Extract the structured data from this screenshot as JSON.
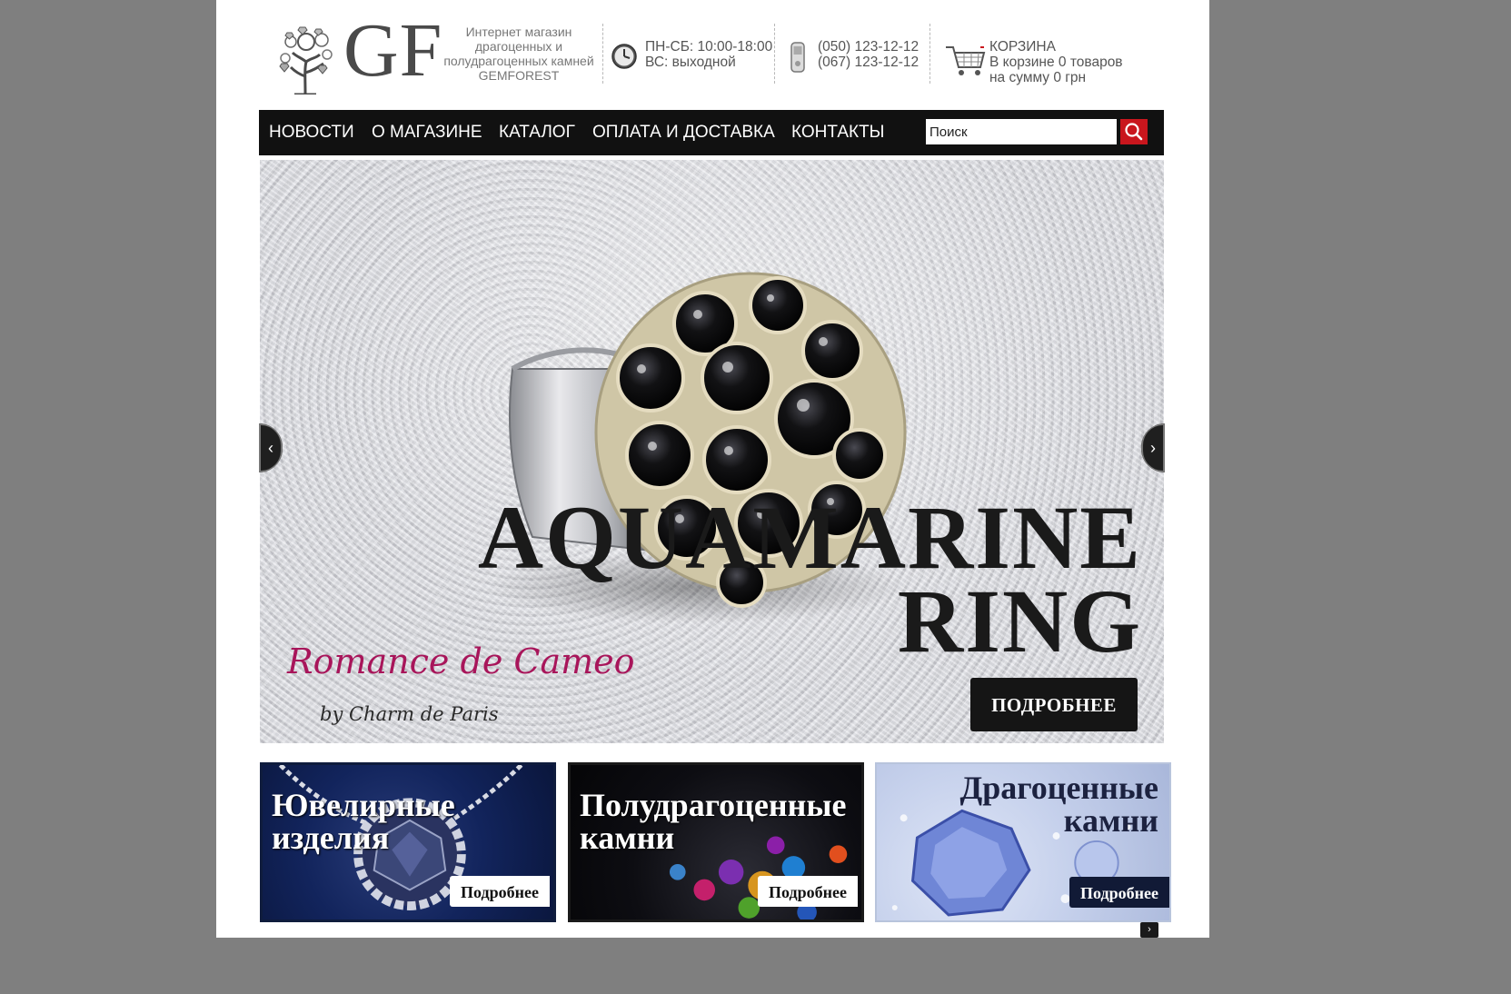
{
  "header": {
    "logo_text": "GF",
    "tagline": [
      "Интернет магазин",
      "драгоценных и",
      "полудрагоценных камней",
      "GEMFOREST"
    ],
    "hours": [
      "ПН-СБ: 10:00-18:00",
      "ВС: выходной"
    ],
    "phones": [
      "(050) 123-12-12",
      "(067) 123-12-12"
    ],
    "cart": {
      "title": "КОРЗИНА",
      "items_line": "В корзине 0 товаров",
      "sum_line": "на сумму 0 грн"
    }
  },
  "nav": {
    "items": [
      "НОВОСТИ",
      "О МАГАЗИНЕ",
      "КАТАЛОГ",
      "ОПЛАТА И ДОСТАВКА",
      "КОНТАКТЫ"
    ],
    "search_placeholder": "Поиск",
    "search_button_icon": "search-icon"
  },
  "hero": {
    "title_line1": "AQUAMARINE",
    "title_line2": "RING",
    "brand_script": "Romance de Cameo",
    "brand_by": "by Charm de Paris",
    "button_label": "ПОДРОБНЕЕ",
    "prev_icon": "chevron-left-icon",
    "next_icon": "chevron-right-icon",
    "prev_glyph": "‹",
    "next_glyph": "›"
  },
  "categories": [
    {
      "title": [
        "Ювелирные",
        "изделия"
      ],
      "button": "Подробнее"
    },
    {
      "title": [
        "Полудрагоценные",
        "камни"
      ],
      "button": "Подробнее"
    },
    {
      "title": [
        "Драгоценные",
        "камни"
      ],
      "button": "Подробнее"
    }
  ],
  "carousel_next_glyph": "›",
  "colors": {
    "background": "#7f7f7f",
    "nav_bg": "#111111",
    "search_button": "#c9161d",
    "brand_script": "#a8155a"
  }
}
